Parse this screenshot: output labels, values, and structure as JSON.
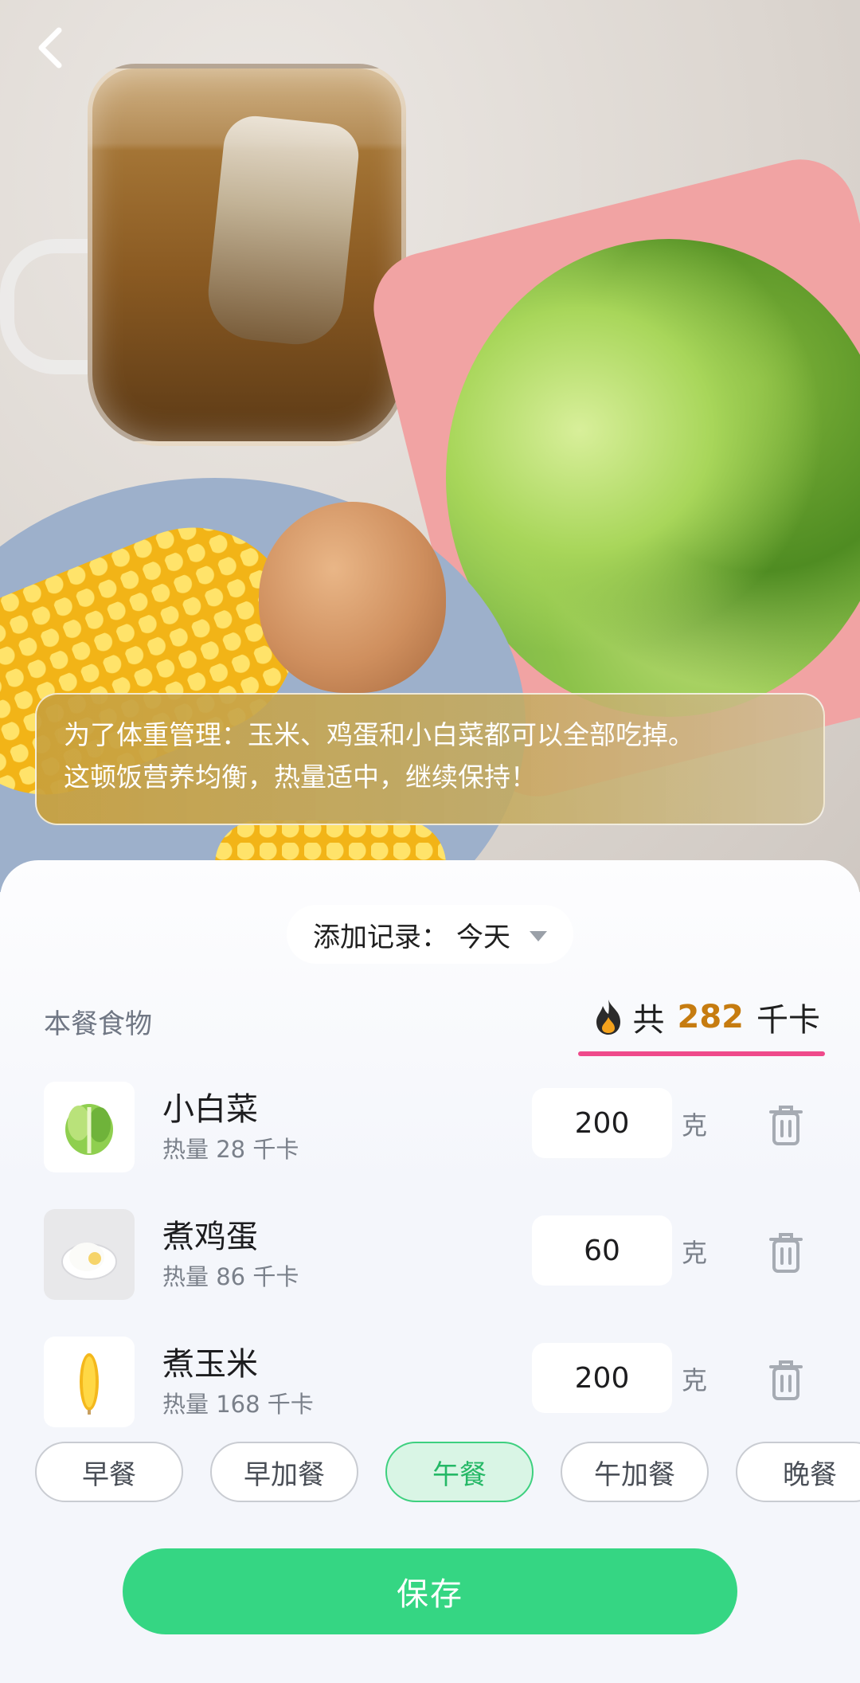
{
  "header": {
    "back_icon": "chevron-left-icon"
  },
  "advice": {
    "line1": "为了体重管理：玉米、鸡蛋和小白菜都可以全部吃掉。",
    "line2": "这顿饭营养均衡，热量适中，继续保持！"
  },
  "record": {
    "label": "添加记录：",
    "value": "今天"
  },
  "meal_foods": {
    "title": "本餐食物",
    "total_prefix": "共",
    "total_value": "282",
    "total_unit": "千卡"
  },
  "foods": [
    {
      "name": "小白菜",
      "calories": "热量 28 千卡",
      "quantity": "200",
      "unit": "克",
      "thumb": "lettuce"
    },
    {
      "name": "煮鸡蛋",
      "calories": "热量 86 千卡",
      "quantity": "60",
      "unit": "克",
      "thumb": "boiled-egg"
    },
    {
      "name": "煮玉米",
      "calories": "热量 168 千卡",
      "quantity": "200",
      "unit": "克",
      "thumb": "corn"
    }
  ],
  "meal_tabs": [
    {
      "label": "早餐",
      "active": false
    },
    {
      "label": "早加餐",
      "active": false
    },
    {
      "label": "午餐",
      "active": true
    },
    {
      "label": "午加餐",
      "active": false
    },
    {
      "label": "晚餐",
      "active": false
    }
  ],
  "save_label": "保存",
  "colors": {
    "accent_green": "#35d683",
    "total_orange": "#c67c10",
    "underline_pink": "#ef4a8b"
  }
}
